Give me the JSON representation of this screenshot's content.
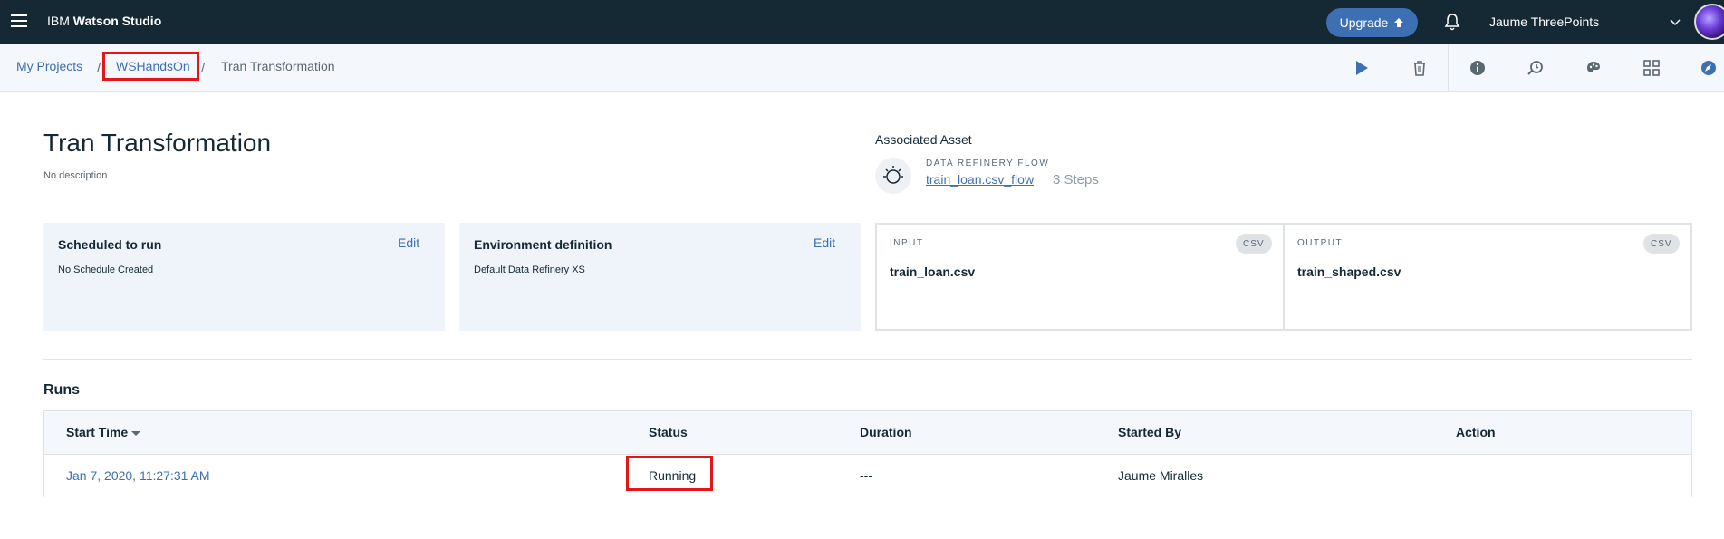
{
  "app": {
    "brand_prefix": "IBM",
    "brand_name": "Watson Studio",
    "upgrade_label": "Upgrade",
    "user_name": "Jaume ThreePoints"
  },
  "breadcrumb": {
    "items": [
      "My Projects",
      "WSHandsOn",
      "Tran Transformation"
    ],
    "separator": "/"
  },
  "toolbar": {
    "icons": [
      "play-icon",
      "trash-icon",
      "info-icon",
      "schedule-icon",
      "palette-icon",
      "grid-icon",
      "compass-icon"
    ]
  },
  "job": {
    "title": "Tran Transformation",
    "description": "No description"
  },
  "associated_asset": {
    "label": "Associated Asset",
    "kicker": "DATA REFINERY FLOW",
    "flow_name": "train_loan.csv_flow",
    "steps": "3 Steps"
  },
  "schedule_card": {
    "title": "Scheduled to run",
    "edit_label": "Edit",
    "value": "No Schedule Created"
  },
  "environment_card": {
    "title": "Environment definition",
    "edit_label": "Edit",
    "value": "Default Data Refinery XS"
  },
  "input_card": {
    "kicker": "INPUT",
    "badge": "CSV",
    "file": "train_loan.csv"
  },
  "output_card": {
    "kicker": "OUTPUT",
    "badge": "CSV",
    "file": "train_shaped.csv"
  },
  "runs": {
    "title": "Runs",
    "columns": [
      "Start Time",
      "Status",
      "Duration",
      "Started By",
      "Action"
    ],
    "rows": [
      {
        "start_time": "Jan 7, 2020, 11:27:31 AM",
        "status": "Running",
        "duration": "---",
        "started_by": "Jaume Miralles",
        "action": ""
      }
    ]
  },
  "colors": {
    "nav_bg": "#152935",
    "link": "#3d70b2",
    "highlight_box": "#e3161b",
    "card_bg": "#eef4fa"
  }
}
